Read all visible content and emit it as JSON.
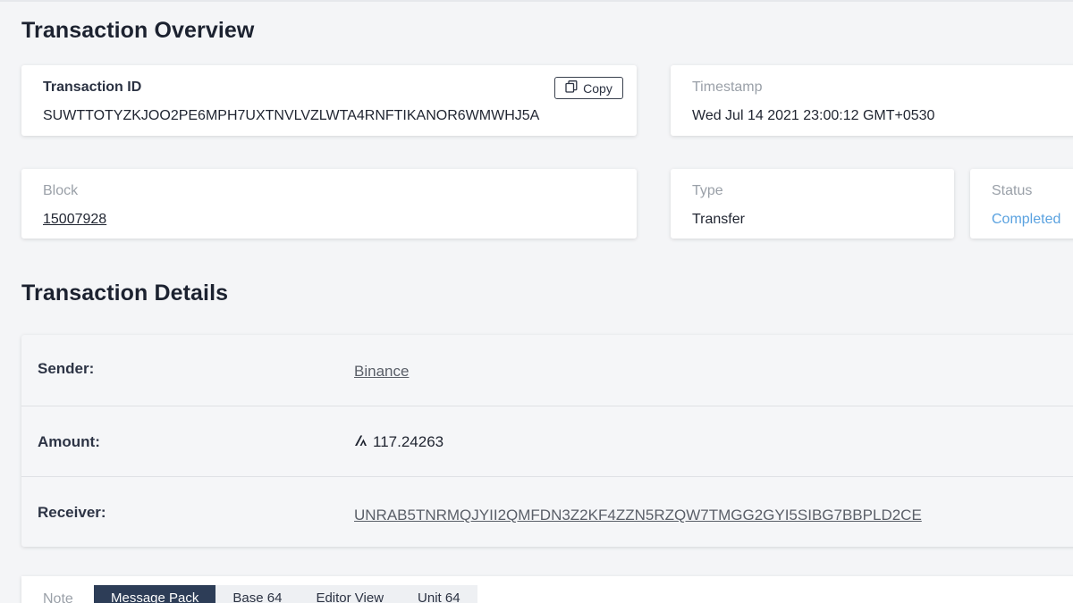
{
  "overview": {
    "title": "Transaction Overview",
    "transaction_id": {
      "label": "Transaction ID",
      "value": "SUWTTOTYZKJOO2PE6MPH7UXTNVLVZLWTA4RNFTIKANOR6WMWHJ5A",
      "copy_label": "Copy"
    },
    "timestamp": {
      "label": "Timestamp",
      "value": "Wed Jul 14 2021 23:00:12 GMT+0530"
    },
    "block": {
      "label": "Block",
      "value": "15007928"
    },
    "type": {
      "label": "Type",
      "value": "Transfer"
    },
    "status": {
      "label": "Status",
      "value": "Completed",
      "color": "#5aa2e0"
    }
  },
  "details": {
    "title": "Transaction Details",
    "rows": [
      {
        "key": "Sender:",
        "value": "Binance"
      },
      {
        "key": "Amount:",
        "value": "117.24263",
        "icon": "algo-icon"
      },
      {
        "key": "Receiver:",
        "value": "UNRAB5TNRMQJYII2QMFDN3Z2KF4ZZN5RZQW7TMGG2GYI5SIBG7BBPLD2CE"
      }
    ]
  },
  "note": {
    "label": "Note",
    "tabs": [
      "Message Pack",
      "Base 64",
      "Editor View",
      "Unit 64"
    ],
    "active_tab": "Message Pack"
  },
  "colors": {
    "accent_dark": "#2d3d57",
    "status_blue": "#5aa2e0"
  }
}
